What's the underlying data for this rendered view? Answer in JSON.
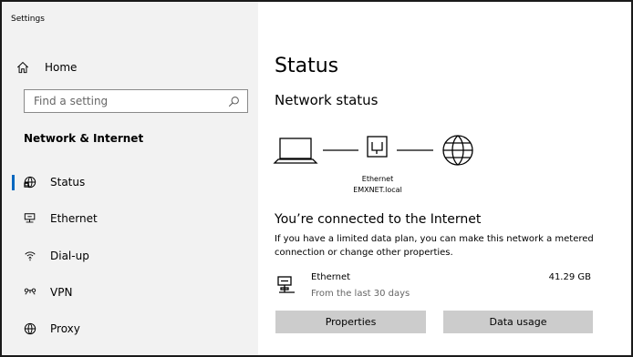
{
  "window": {
    "title": "Settings"
  },
  "sidebar": {
    "home_label": "Home",
    "search_placeholder": "Find a setting",
    "section_title": "Network & Internet",
    "items": [
      {
        "label": "Status",
        "icon": "status-globe-icon",
        "active": true
      },
      {
        "label": "Ethernet",
        "icon": "ethernet-icon",
        "active": false
      },
      {
        "label": "Dial-up",
        "icon": "dial-up-icon",
        "active": false
      },
      {
        "label": "VPN",
        "icon": "vpn-icon",
        "active": false
      },
      {
        "label": "Proxy",
        "icon": "globe-icon",
        "active": false
      }
    ]
  },
  "main": {
    "title": "Status",
    "subheading": "Network status",
    "diagram": {
      "adapter_label": "Ethernet",
      "network_name": "EMXNET.local"
    },
    "connection_message": "You’re connected to the Internet",
    "description": "If you have a limited data plan, you can make this network a metered connection or change other properties.",
    "usage": {
      "name": "Ethernet",
      "period": "From the last 30 days",
      "amount": "41.29 GB"
    },
    "buttons": {
      "properties": "Properties",
      "data_usage": "Data usage"
    }
  },
  "colors": {
    "accent": "#0067c0",
    "sidebar_bg": "#f2f2f2",
    "button_bg": "#cccccc"
  }
}
